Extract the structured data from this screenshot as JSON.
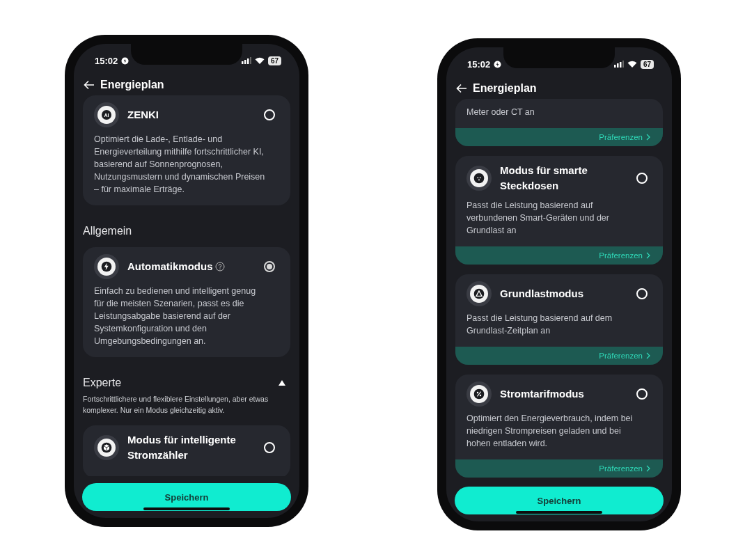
{
  "phones": [
    {
      "status": {
        "time": "15:02",
        "battery": "67"
      },
      "title": "Energieplan",
      "save_button": "Speichern",
      "content": [
        {
          "kind": "card",
          "icon_label": "AI",
          "title": "ZENKI",
          "selected": false,
          "description": "Optimiert die Lade-, Entlade- und Energieverteilung mithilfe fortschrittlicher KI, basierend auf Sonnenprognosen, Nutzungsmustern und dynamischen Preisen – für maximale Erträge."
        },
        {
          "kind": "section",
          "title": "Allgemein"
        },
        {
          "kind": "card",
          "title": "Automatikmodus",
          "help": true,
          "selected": true,
          "description": "Einfach zu bedienen und intelligent genug für die meisten Szenarien, passt es die Leistungsabgabe basierend auf der Systemkonfiguration und den Umgebungsbedingungen an."
        },
        {
          "kind": "section",
          "title": "Experte",
          "expanded": true
        },
        {
          "kind": "note",
          "text": "Fortschrittlichere und flexiblere Einstellungen, aber etwas komplexer. Nur ein Modus gleichzeitig aktiv."
        },
        {
          "kind": "card",
          "title": "Modus für intelligente Stromzähler",
          "selected": false
        }
      ]
    },
    {
      "status": {
        "time": "15:02",
        "battery": "67"
      },
      "title": "Energieplan",
      "save_button": "Speichern",
      "content": [
        {
          "kind": "card",
          "description": "Meter oder CT an",
          "preferences": "Präferenzen"
        },
        {
          "kind": "card",
          "title": "Modus für smarte Steckdosen",
          "selected": false,
          "description": "Passt die Leistung basierend auf verbundenen Smart-Geräten und der Grundlast an",
          "preferences": "Präferenzen"
        },
        {
          "kind": "card",
          "title": "Grundlastmodus",
          "selected": false,
          "description": "Passt die Leistung basierend auf dem Grundlast-Zeitplan an",
          "preferences": "Präferenzen"
        },
        {
          "kind": "card",
          "title": "Stromtarifmodus",
          "selected": false,
          "description": "Optimiert den Energieverbrauch, indem bei niedrigen Strompreisen geladen und bei hohen entladen wird.",
          "preferences": "Präferenzen"
        }
      ]
    }
  ]
}
